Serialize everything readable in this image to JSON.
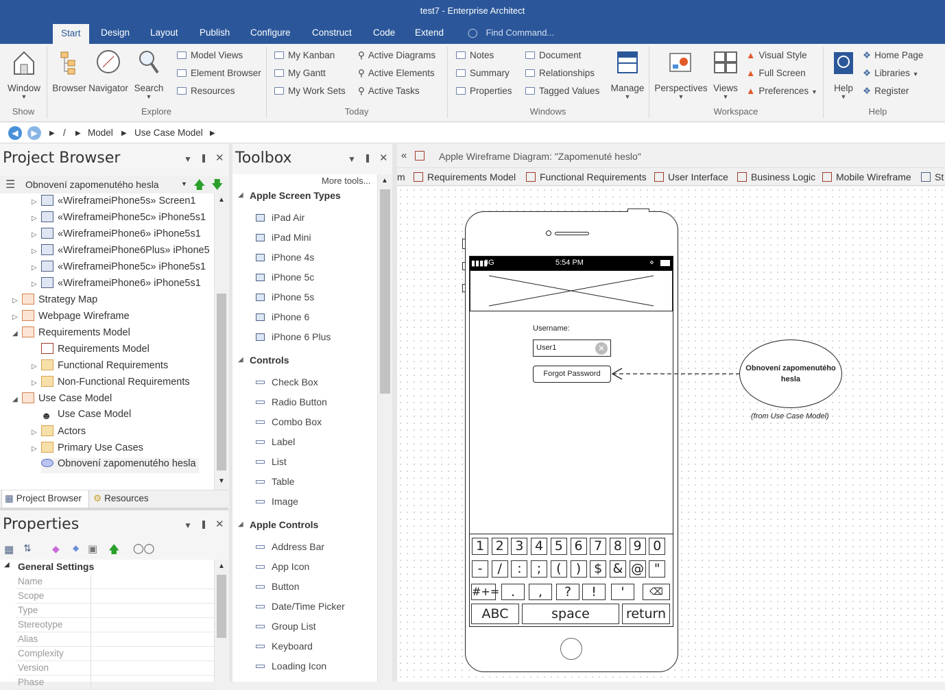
{
  "window": {
    "title": "test7 - Enterprise Architect"
  },
  "menu_tabs": [
    "Start",
    "Design",
    "Layout",
    "Publish",
    "Configure",
    "Construct",
    "Code",
    "Extend"
  ],
  "find_command": "Find Command...",
  "ribbon": {
    "show": {
      "window": "Window",
      "label": "Show"
    },
    "explore": {
      "browser": "Browser",
      "navigator": "Navigator",
      "search": "Search",
      "items": [
        "Model Views",
        "Element Browser",
        "Resources"
      ],
      "label": "Explore"
    },
    "today": {
      "col1": [
        "My Kanban",
        "My Gantt",
        "My Work Sets"
      ],
      "col2": [
        "Active Diagrams",
        "Active Elements",
        "Active Tasks"
      ],
      "label": "Today"
    },
    "windows": {
      "col1": [
        "Notes",
        "Summary",
        "Properties"
      ],
      "col2": [
        "Document",
        "Relationships",
        "Tagged Values"
      ],
      "manage": "Manage",
      "label": "Windows"
    },
    "workspace": {
      "perspectives": "Perspectives",
      "views": "Views",
      "items": [
        "Visual Style",
        "Full Screen",
        "Preferences"
      ],
      "label": "Workspace"
    },
    "help": {
      "help": "Help",
      "items": [
        "Home Page",
        "Libraries",
        "Register"
      ],
      "label": "Help"
    }
  },
  "breadcrumb": [
    "/",
    "Model",
    "Use Case Model"
  ],
  "project_browser": {
    "title": "Project Browser",
    "selector": "Obnovení zapomenutého hesla",
    "items": [
      "«WireframeiPhone5s» Screen1",
      "«WireframeiPhone5c» iPhone5s1",
      "«WireframeiPhone6» iPhone5s1",
      "«WireframeiPhone6Plus» iPhone5",
      "«WireframeiPhone5c» iPhone5s1",
      "«WireframeiPhone6» iPhone5s1",
      "Strategy Map",
      "Webpage Wireframe",
      "Requirements Model",
      "Requirements Model",
      "Functional Requirements",
      "Non-Functional Requirements",
      "Use Case Model",
      "Use Case Model",
      "Actors",
      "Primary Use Cases",
      "Obnovení zapomenutého hesla"
    ],
    "bottom_tabs": [
      "Project Browser",
      "Resources"
    ]
  },
  "properties": {
    "title": "Properties",
    "section": "General Settings",
    "rows": [
      "Name",
      "Scope",
      "Type",
      "Stereotype",
      "Alias",
      "Complexity",
      "Version",
      "Phase"
    ]
  },
  "toolbox": {
    "title": "Toolbox",
    "more": "More tools...",
    "sections": [
      {
        "name": "Apple Screen Types",
        "items": [
          "iPad Air",
          "iPad Mini",
          "iPhone 4s",
          "iPhone 5c",
          "iPhone 5s",
          "iPhone 6",
          "iPhone 6 Plus"
        ]
      },
      {
        "name": "Controls",
        "items": [
          "Check Box",
          "Radio Button",
          "Combo Box",
          "Label",
          "List",
          "Table",
          "Image"
        ]
      },
      {
        "name": "Apple Controls",
        "items": [
          "Address Bar",
          "App Icon",
          "Button",
          "Date/Time Picker",
          "Group List",
          "Keyboard",
          "Loading Icon"
        ]
      }
    ]
  },
  "diagram": {
    "title": "Apple Wireframe Diagram: \"Zapomenuté heslo\"",
    "tabs": [
      "m",
      "Requirements Model",
      "Functional Requirements",
      "User Interface",
      "Business Logic",
      "Mobile Wireframe",
      "St"
    ],
    "phone": {
      "signal": "3G",
      "time": "5:54 PM",
      "username_label": "Username:",
      "username_value": "User1",
      "forgot_button": "Forgot Password",
      "keys_row1": [
        "1",
        "2",
        "3",
        "4",
        "5",
        "6",
        "7",
        "8",
        "9",
        "0"
      ],
      "keys_row2": [
        "-",
        "/",
        ":",
        ";",
        "(",
        ")",
        "$",
        "&",
        "@",
        "\""
      ],
      "keys_row3": [
        "#+=",
        ".",
        ",",
        "?",
        "!",
        "'"
      ],
      "abc": "ABC",
      "space": "space",
      "return": "return"
    },
    "usecase": {
      "name": "Obnovení zapomenutého hesla",
      "note": "(from Use Case Model)"
    }
  }
}
